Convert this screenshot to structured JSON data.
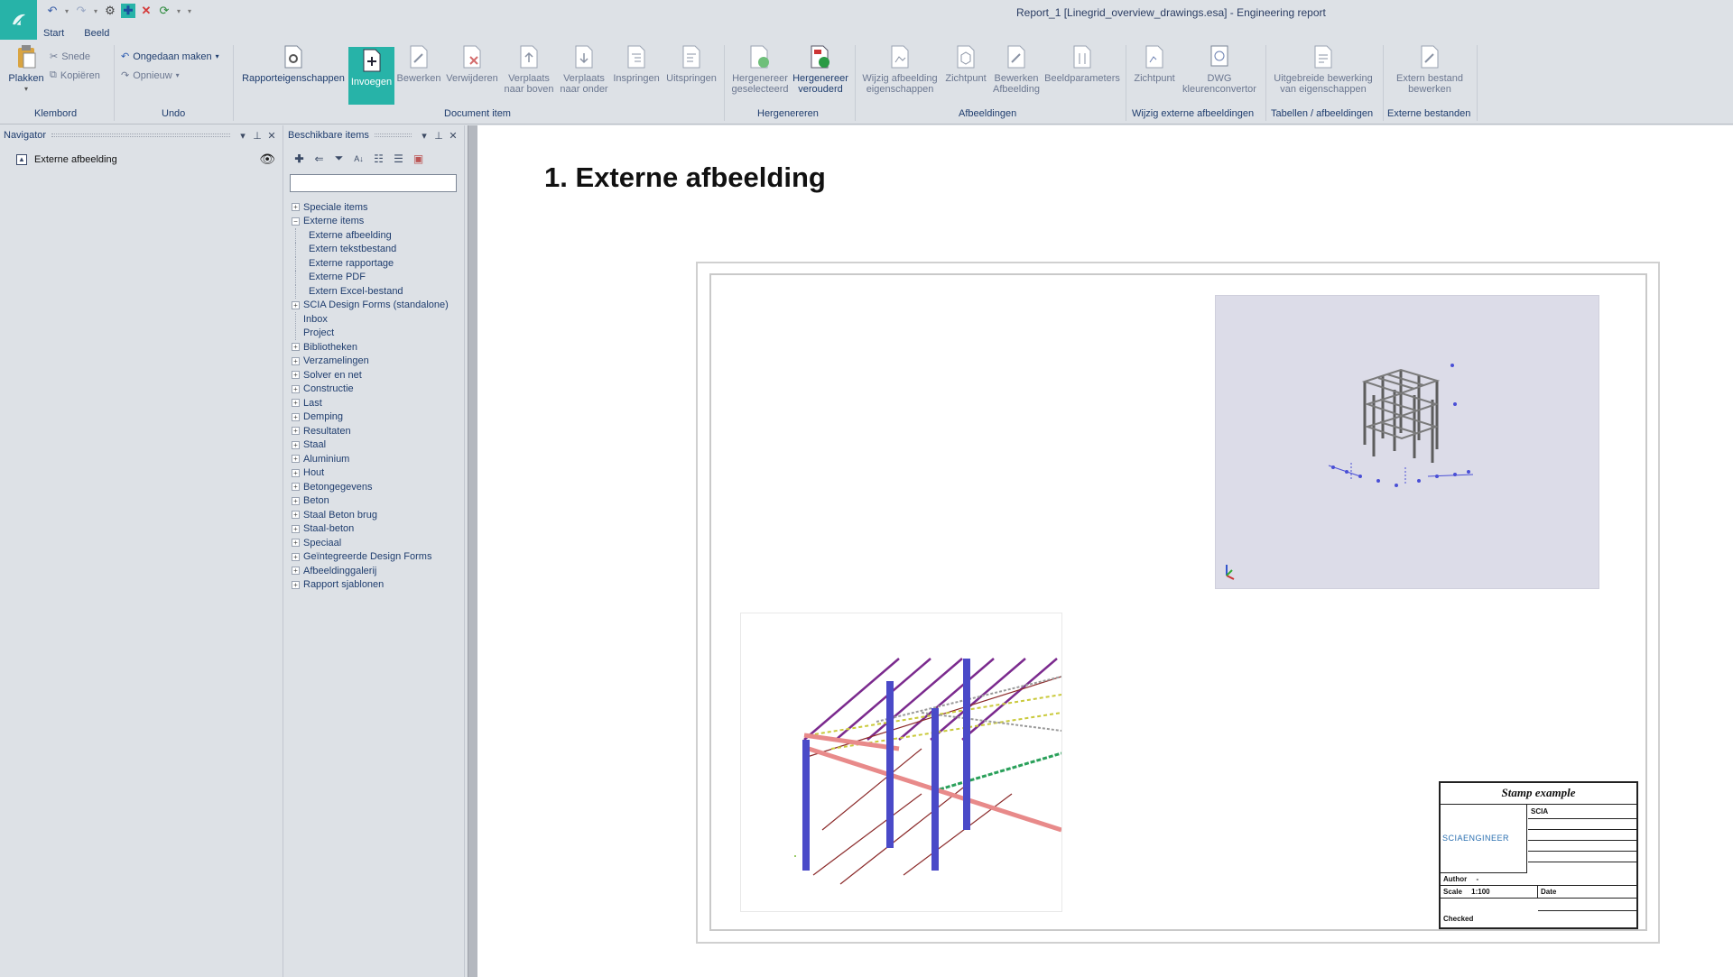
{
  "window": {
    "title": "Report_1 [Linegrid_overview_drawings.esa] - Engineering report"
  },
  "tabs": [
    "Start",
    "Beeld"
  ],
  "ribbon": {
    "klembord": {
      "paste": "Plakken",
      "cut": "Snede",
      "copy": "Kopiëren",
      "group": "Klembord"
    },
    "undo": {
      "undo": "Ongedaan maken",
      "redo": "Opnieuw",
      "group": "Undo"
    },
    "document_item": {
      "group": "Document item",
      "props": "Rapporteigenschappen",
      "insert": "Invoegen",
      "edit": "Bewerken",
      "delete": "Verwijderen",
      "move_up_1": "Verplaats",
      "move_up_2": "naar boven",
      "move_down_1": "Verplaats",
      "move_down_2": "naar onder",
      "indent": "Inspringen",
      "outdent": "Uitspringen"
    },
    "hergenereren": {
      "group": "Hergenereren",
      "sel_1": "Hergenereer",
      "sel_2": "geselecteerd",
      "old_1": "Hergenereer",
      "old_2": "verouderd"
    },
    "afbeeldingen": {
      "group": "Afbeeldingen",
      "props_1": "Wijzig afbeelding",
      "props_2": "eigenschappen",
      "viewpoint": "Zichtpunt",
      "edit_1": "Bewerken",
      "edit_2": "Afbeelding",
      "params": "Beeldparameters"
    },
    "extern": {
      "group": "Wijzig externe afbeeldingen",
      "viewpoint": "Zichtpunt",
      "dwg_1": "DWG",
      "dwg_2": "kleurenconvertor"
    },
    "tabellen": {
      "group": "Tabellen / afbeeldingen",
      "adv_1": "Uitgebreide bewerking",
      "adv_2": "van eigenschappen"
    },
    "bestanden": {
      "group": "Externe bestanden",
      "edit_1": "Extern bestand",
      "edit_2": "bewerken"
    }
  },
  "navigator": {
    "title": "Navigator",
    "items": [
      "Externe afbeelding"
    ]
  },
  "available_items": {
    "title": "Beschikbare items",
    "search_placeholder": "",
    "tree": [
      {
        "label": "Speciale items",
        "expand": "+",
        "level": 0
      },
      {
        "label": "Externe items",
        "expand": "−",
        "level": 0
      },
      {
        "label": "Externe afbeelding",
        "expand": "",
        "level": 1
      },
      {
        "label": "Extern tekstbestand",
        "expand": "",
        "level": 1
      },
      {
        "label": "Externe rapportage",
        "expand": "",
        "level": 1
      },
      {
        "label": "Externe PDF",
        "expand": "",
        "level": 1
      },
      {
        "label": "Extern Excel-bestand",
        "expand": "",
        "level": 1
      },
      {
        "label": "SCIA Design Forms (standalone)",
        "expand": "+",
        "level": 0
      },
      {
        "label": "Inbox",
        "expand": "",
        "level": 0
      },
      {
        "label": "Project",
        "expand": "",
        "level": 0
      },
      {
        "label": "Bibliotheken",
        "expand": "+",
        "level": 0
      },
      {
        "label": "Verzamelingen",
        "expand": "+",
        "level": 0
      },
      {
        "label": "Solver en net",
        "expand": "+",
        "level": 0
      },
      {
        "label": "Constructie",
        "expand": "+",
        "level": 0
      },
      {
        "label": "Last",
        "expand": "+",
        "level": 0
      },
      {
        "label": "Demping",
        "expand": "+",
        "level": 0
      },
      {
        "label": "Resultaten",
        "expand": "+",
        "level": 0
      },
      {
        "label": "Staal",
        "expand": "+",
        "level": 0
      },
      {
        "label": "Aluminium",
        "expand": "+",
        "level": 0
      },
      {
        "label": "Hout",
        "expand": "+",
        "level": 0
      },
      {
        "label": "Betongegevens",
        "expand": "+",
        "level": 0
      },
      {
        "label": "Beton",
        "expand": "+",
        "level": 0
      },
      {
        "label": "Staal Beton brug",
        "expand": "+",
        "level": 0
      },
      {
        "label": "Staal-beton",
        "expand": "+",
        "level": 0
      },
      {
        "label": "Speciaal",
        "expand": "+",
        "level": 0
      },
      {
        "label": "Geïntegreerde Design Forms",
        "expand": "+",
        "level": 0
      },
      {
        "label": "Afbeeldinggalerij",
        "expand": "+",
        "level": 0
      },
      {
        "label": "Rapport sjablonen",
        "expand": "+",
        "level": 0
      }
    ]
  },
  "document": {
    "heading": "1. Externe afbeelding",
    "titleblock": {
      "title": "Stamp example",
      "company": "SCIA",
      "brand": "SCIAENGINEER",
      "author": "Author",
      "dash": "-",
      "scale": "Scale",
      "scale_val": "1:100",
      "date": "Date",
      "checked": "Checked"
    }
  },
  "colors": {
    "accent": "#27b3a8",
    "title_text": "#2b3d63",
    "ribbon_text": "#1f3d6e"
  }
}
